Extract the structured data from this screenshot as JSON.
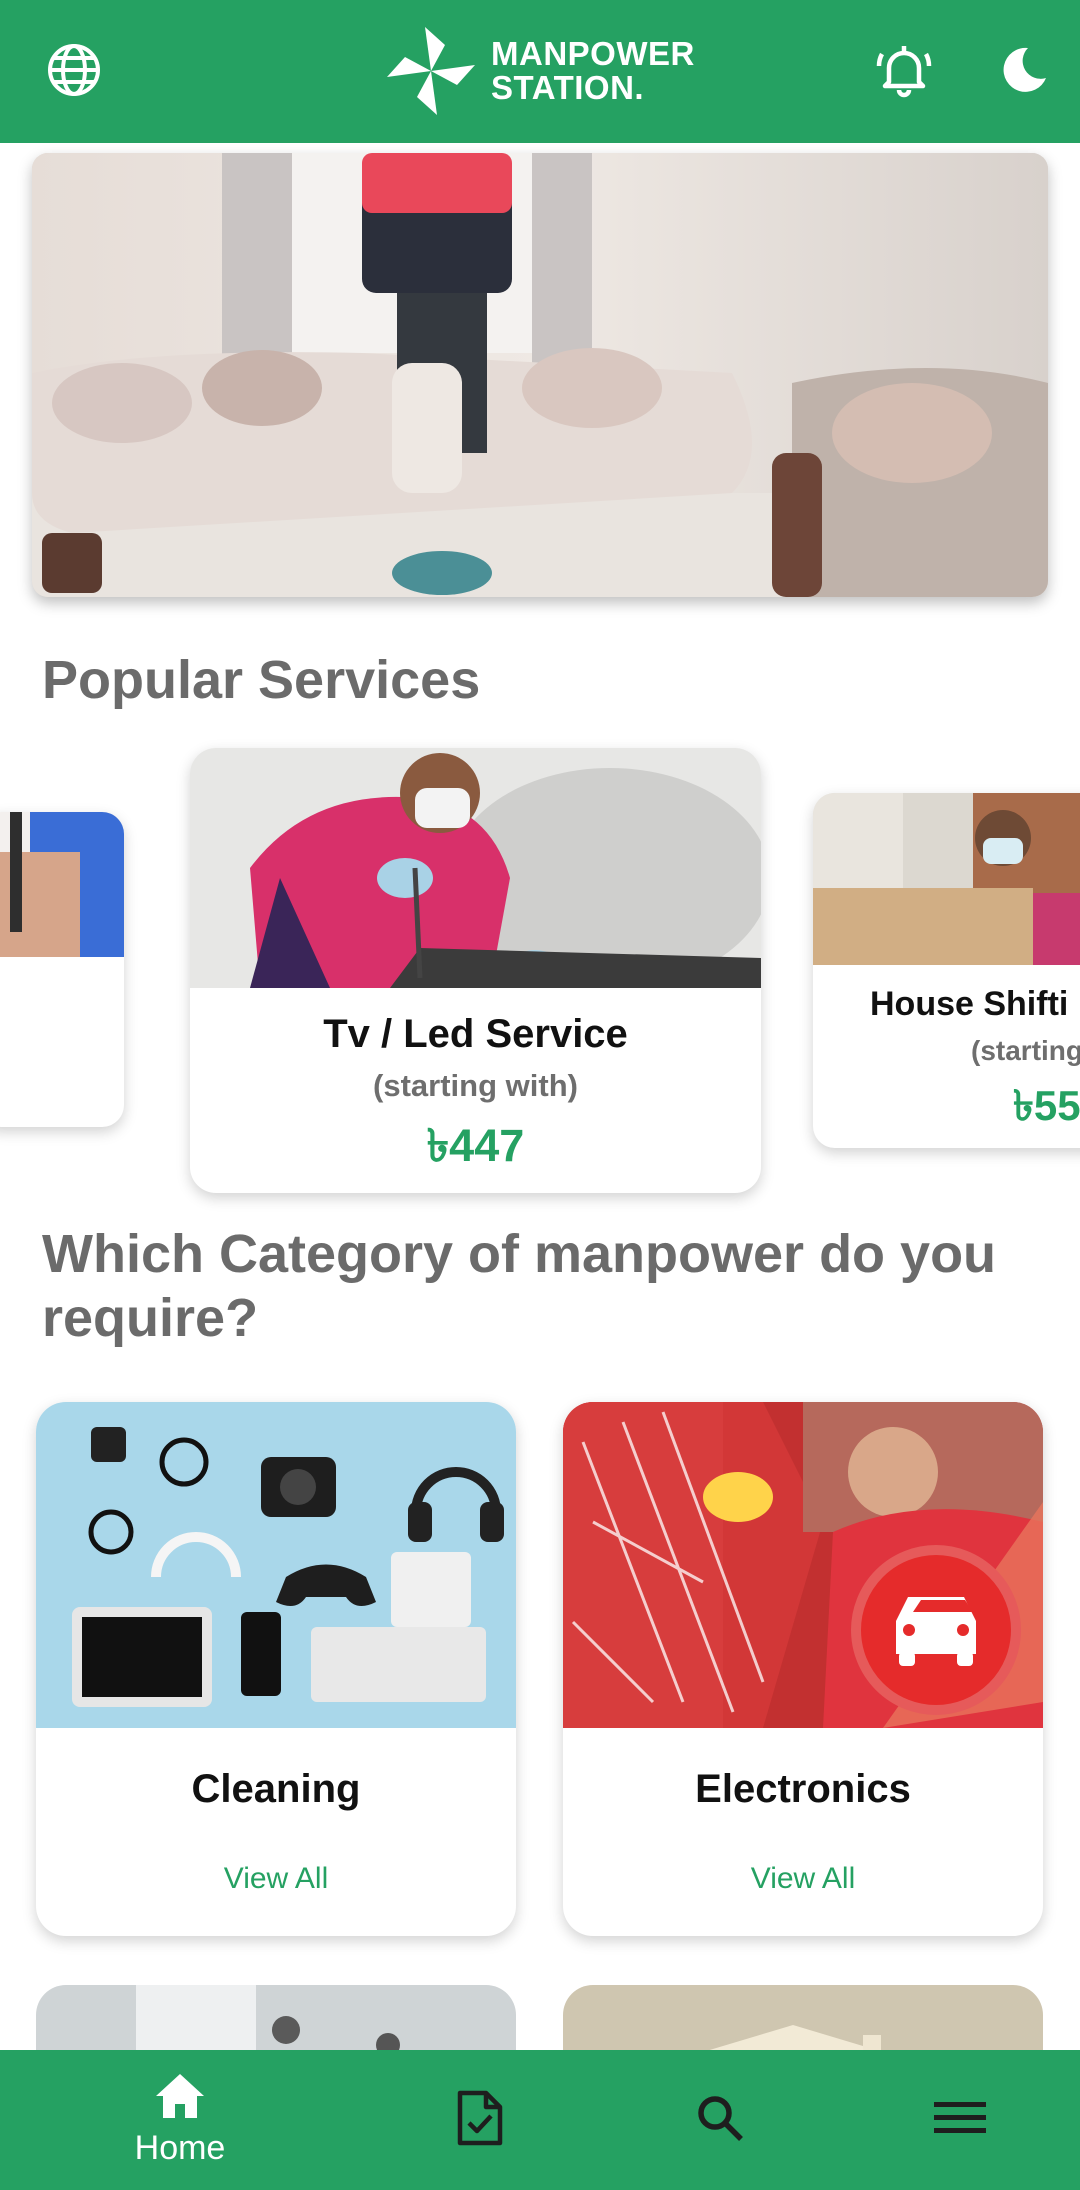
{
  "header": {
    "logo_line1": "MANPOWER",
    "logo_line2": "STATION.",
    "icons": [
      "globe-icon",
      "bell-icon",
      "moon-icon"
    ]
  },
  "popular": {
    "title": "Popular Services",
    "cards": [
      {
        "name": "Tv / Led Service",
        "sub": "(starting with)",
        "price": "৳447"
      },
      {
        "name": "House Shifti",
        "sub": "(starting",
        "price": "৳55"
      }
    ]
  },
  "category": {
    "title_line1": "Which Category of manpower do you",
    "title_line2": "require?",
    "cards": [
      {
        "name": "Cleaning",
        "action": "View All"
      },
      {
        "name": "Electronics",
        "action": "View All"
      }
    ]
  },
  "nav": {
    "home": "Home",
    "icons": [
      "home-icon",
      "orders-icon",
      "search-icon",
      "menu-icon"
    ]
  },
  "colors": {
    "brand": "#25a162",
    "white": "#ffffff",
    "muted_title": "#6b6b6b",
    "badge_red": "#e52b2b"
  }
}
